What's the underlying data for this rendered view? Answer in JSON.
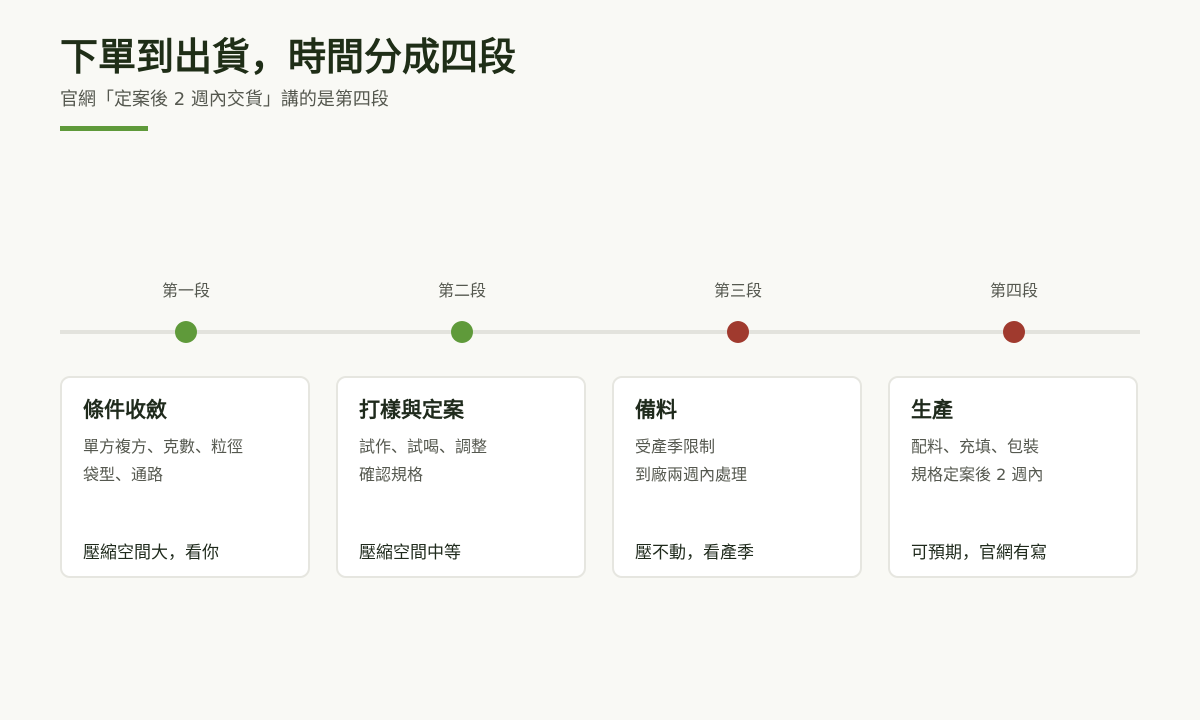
{
  "header": {
    "title": "下單到出貨，時間分成四段",
    "subtitle": "官網「定案後 2 週內交貨」講的是第四段",
    "accent_color": "#5f9a3a"
  },
  "stages": [
    {
      "label": "第一段",
      "color": "#5f9a3a",
      "title": "條件收斂",
      "lines": [
        "單方複方、克數、粒徑",
        "袋型、通路"
      ],
      "foot": "壓縮空間大，看你"
    },
    {
      "label": "第二段",
      "color": "#5f9a3a",
      "title": "打樣與定案",
      "lines": [
        "試作、試喝、調整",
        "確認規格"
      ],
      "foot": "壓縮空間中等"
    },
    {
      "label": "第三段",
      "color": "#a03a2e",
      "title": "備料",
      "lines": [
        "受產季限制",
        "到廠兩週內處理"
      ],
      "foot": "壓不動，看產季"
    },
    {
      "label": "第四段",
      "color": "#a03a2e",
      "title": "生產",
      "lines": [
        "配料、充填、包裝",
        "規格定案後 2 週內"
      ],
      "foot": "可預期，官網有寫"
    }
  ]
}
